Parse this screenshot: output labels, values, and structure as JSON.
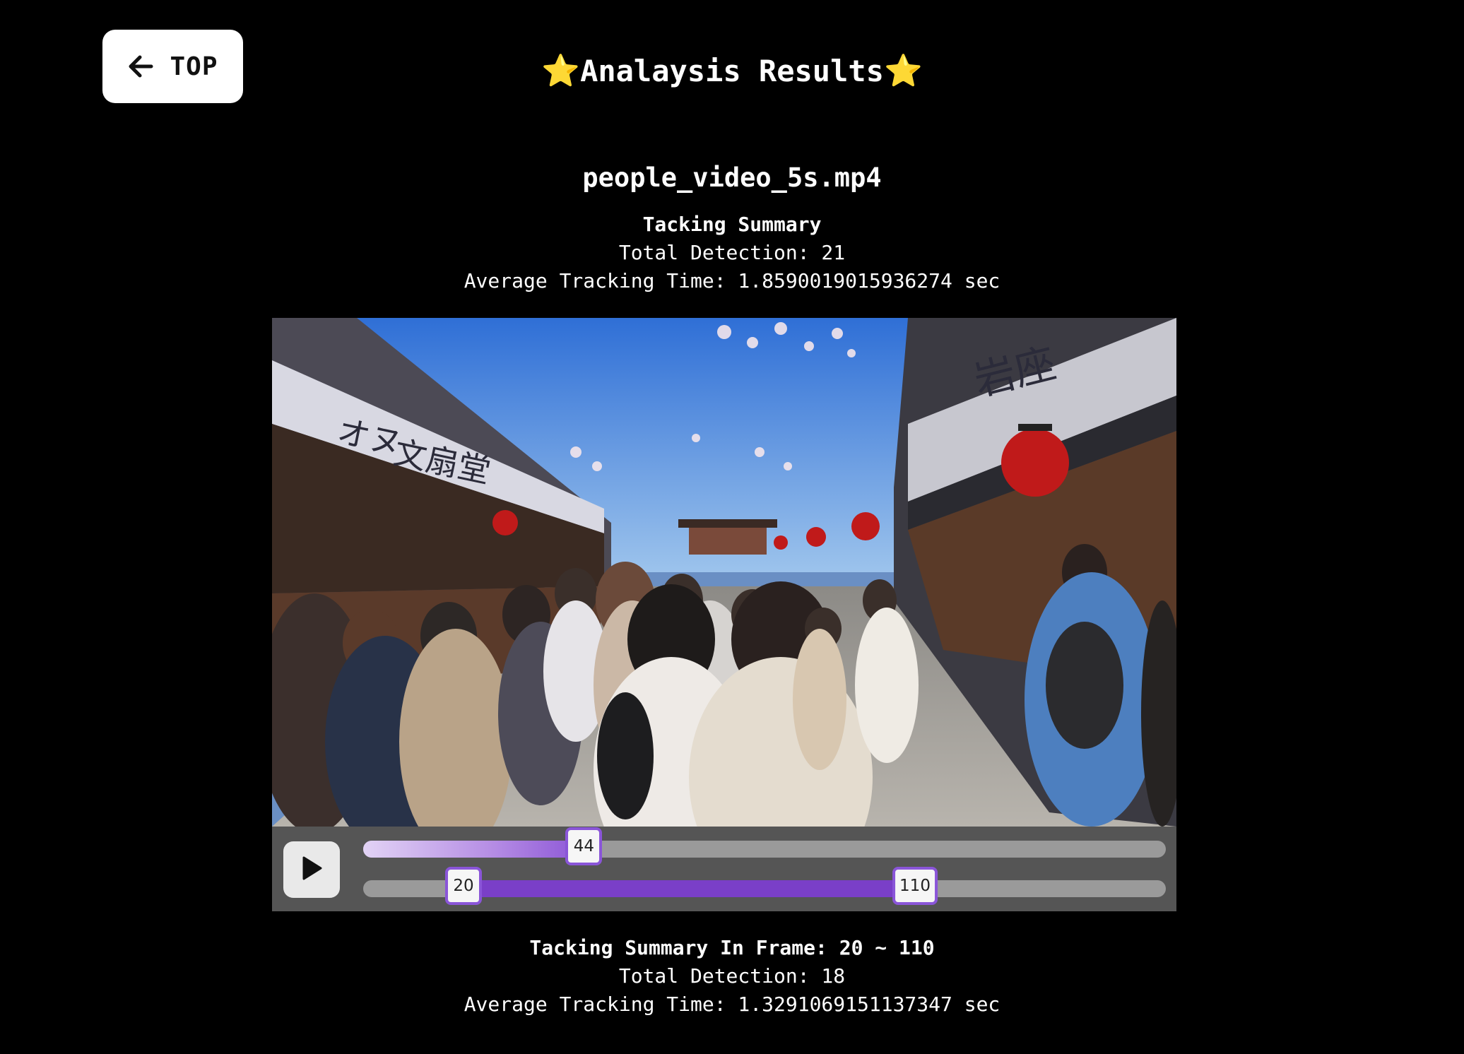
{
  "back_button": {
    "label": "TOP",
    "icon": "arrow-left-icon"
  },
  "page_title": {
    "text": "Analaysis Results",
    "star": "⭐"
  },
  "video_file": {
    "name": "people_video_5s.mp4"
  },
  "overall_summary": {
    "heading": "Tacking Summary",
    "total_detection": "Total Detection: 21",
    "average_time": "Average Tracking Time: 1.8590019015936274 sec"
  },
  "player": {
    "play_icon": "play-icon",
    "frame_min": 0,
    "frame_max": 160,
    "current_frame": 44,
    "current_frame_label": "44",
    "range_start": 20,
    "range_start_label": "20",
    "range_end": 110,
    "range_end_label": "110",
    "progress_color": "#8c55d6",
    "range_color": "#7a3fc8"
  },
  "range_summary": {
    "heading": "Tacking Summary In Frame: 20 ~ 110",
    "total_detection": "Total Detection: 18",
    "average_time": "Average Tracking Time: 1.3291069151137347 sec"
  }
}
